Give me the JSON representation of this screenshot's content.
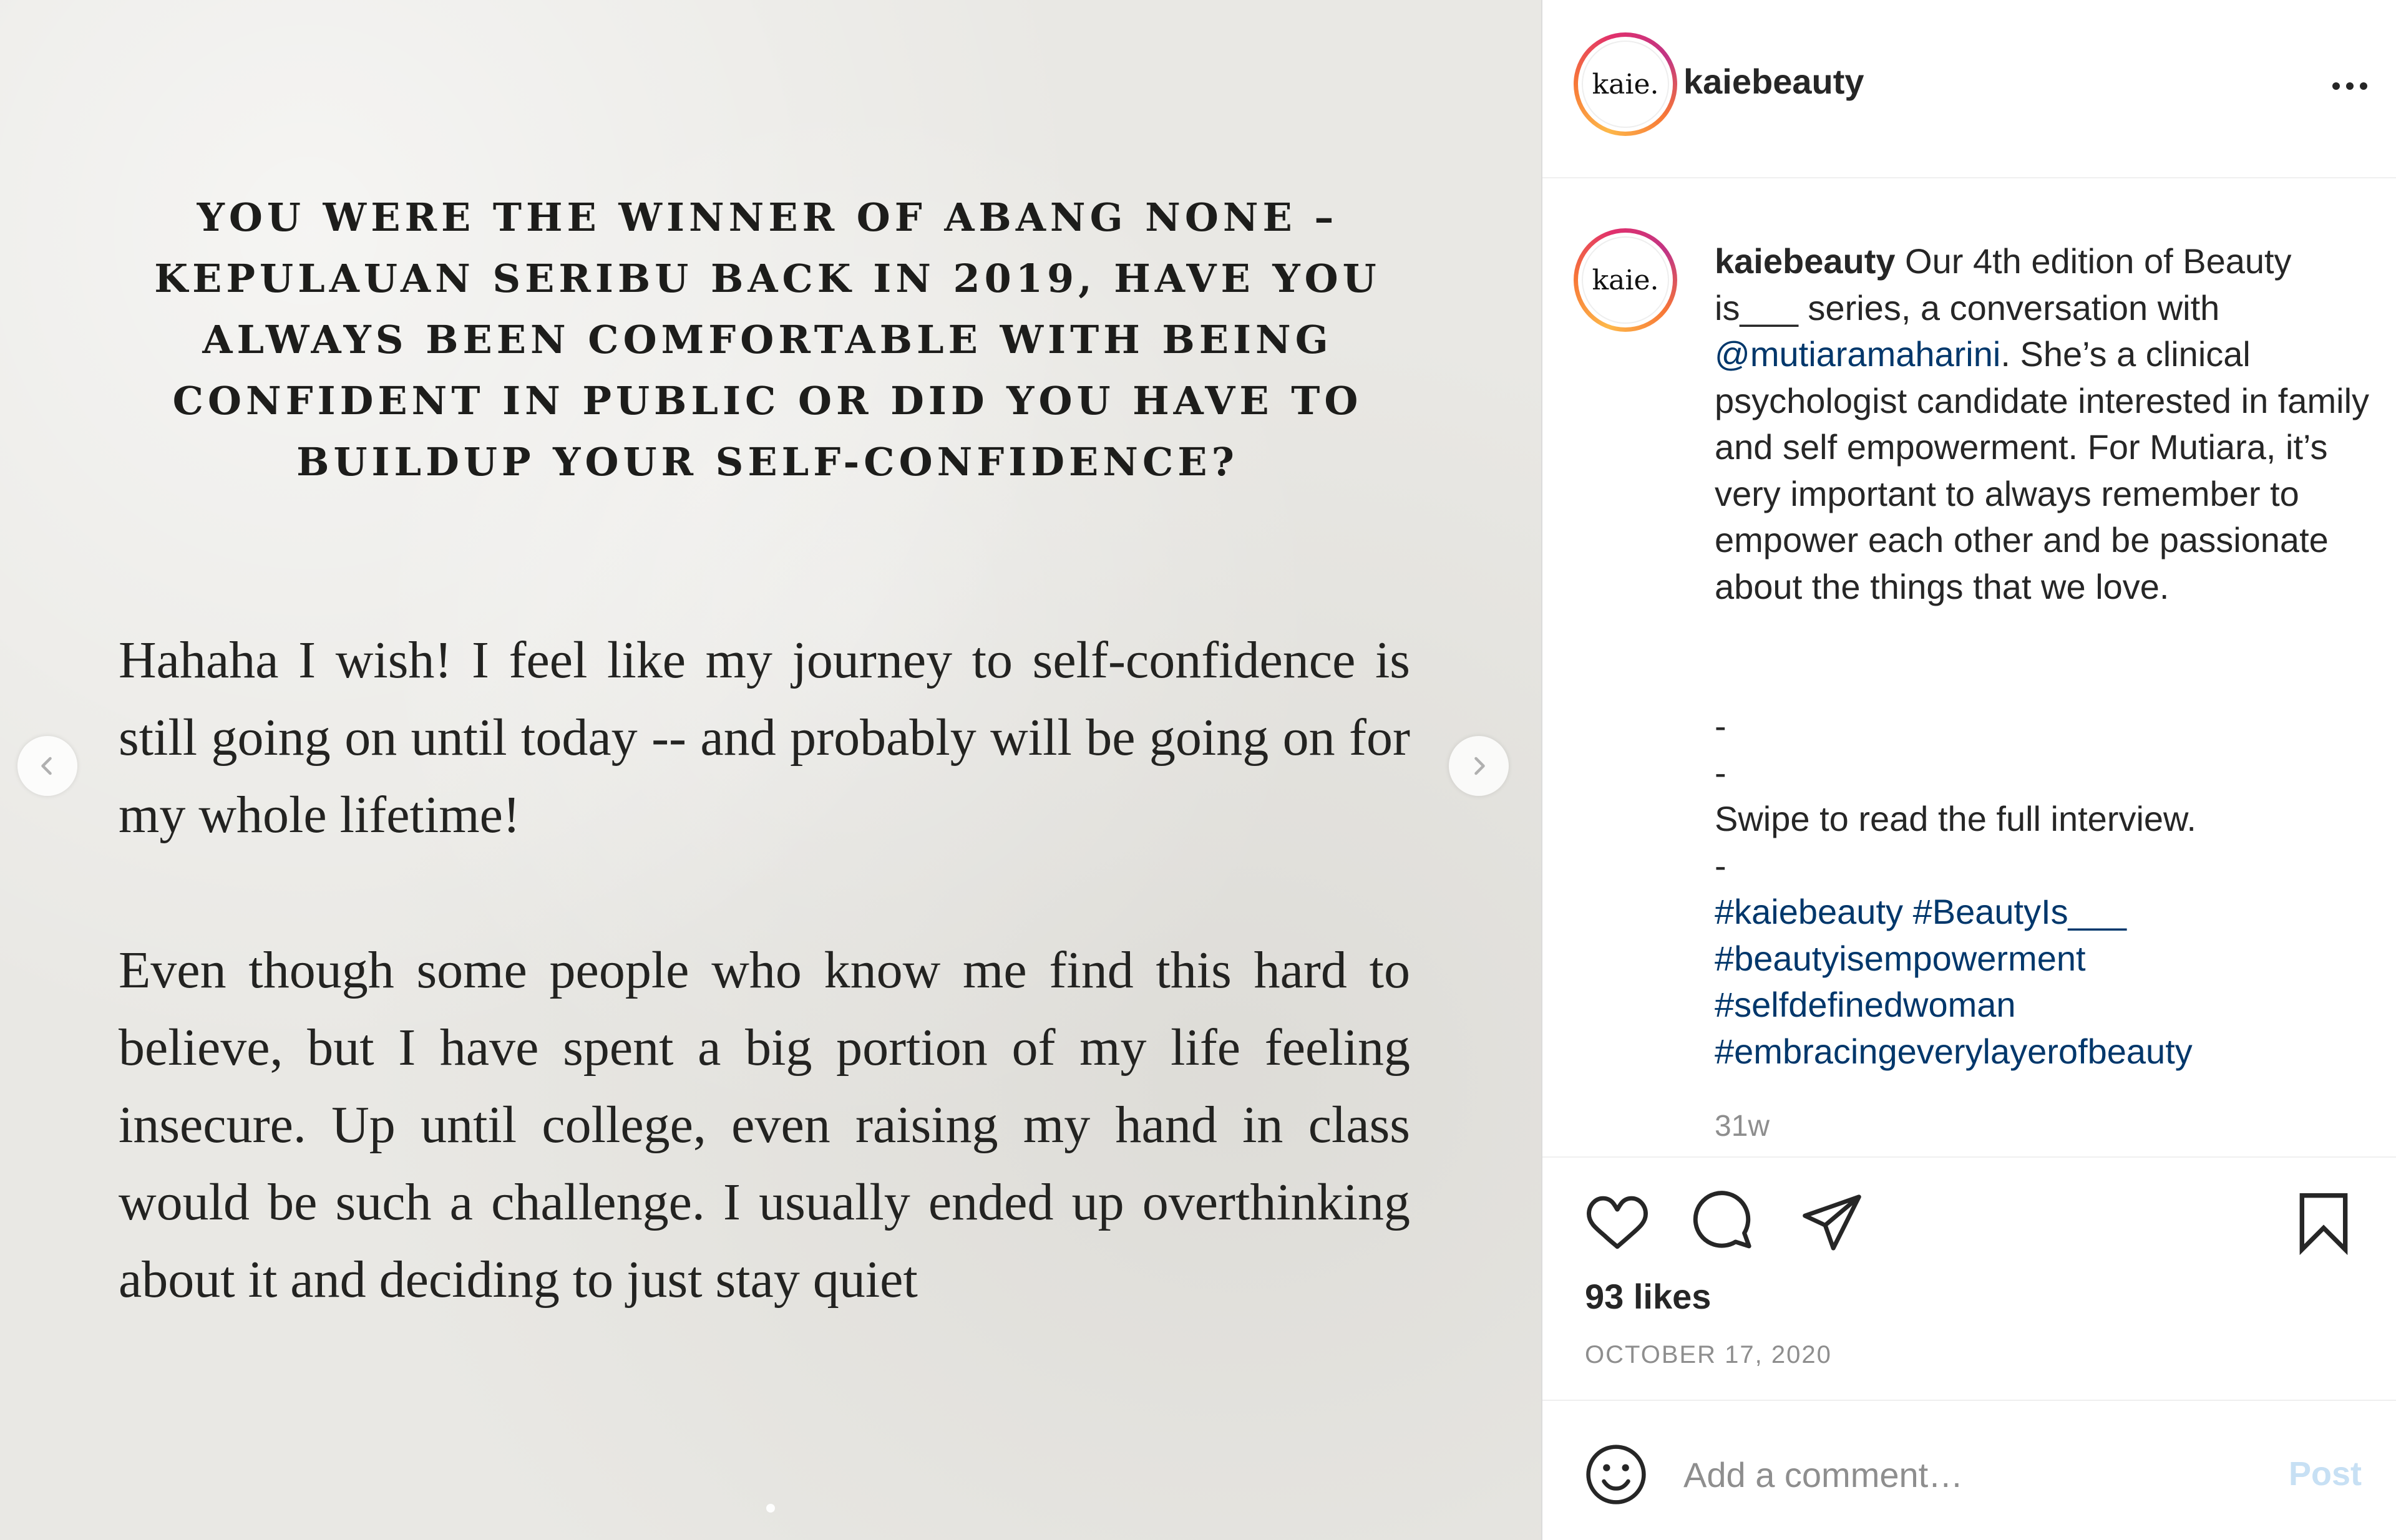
{
  "post": {
    "slide": {
      "heading": "YOU WERE THE WINNER OF ABANG NONE – KEPULAUAN SERIBU BACK IN 2019, HAVE YOU ALWAYS BEEN COMFORTABLE WITH BEING CONFIDENT IN PUBLIC OR DID YOU HAVE TO BUILDUP YOUR SELF-CONFIDENCE?",
      "paragraph_1": "Hahaha I wish! I feel like my journey to self-confidence is still going on until today -- and probably will be going on for my whole lifetime!",
      "paragraph_2": "Even though some people who know me find this hard to believe, but I have spent a big portion of my life feeling insecure. Up until college, even raising my hand in class would be such a challenge. I usually ended up overthinking about it and deciding to just stay quiet"
    },
    "header": {
      "username": "kaiebeauty",
      "avatar_text": "kaie."
    },
    "caption": {
      "username": "kaiebeauty",
      "text_1": " Our 4th edition of Beauty is___ series, a conversation with ",
      "mention": "@mutiaramaharini",
      "text_2": ". She’s a clinical psychologist candidate interested in family and self empowerment. For Mutiara, it’s very important to always remember to empower each other and be passionate about the things that we love.",
      "sep_1": "-",
      "sep_2": "-",
      "swipe": "Swipe to read the full interview.",
      "sep_3": "-",
      "hashtags": [
        "#kaiebeauty",
        "#BeautyIs___",
        "#beautyisempowerment",
        "#selfdefinedwoman",
        "#embracingeverylayerofbeauty"
      ],
      "time": "31w"
    },
    "likes": "93 likes",
    "date": "OCTOBER 17, 2020",
    "comment": {
      "placeholder": "Add a comment…",
      "post_label": "Post"
    }
  },
  "colors": {
    "link": "#00376b",
    "muted": "#8e8e8e",
    "text": "#262626",
    "post_disabled": "#c7e0f4",
    "slide_bg": "#e9e8e4"
  },
  "icons": [
    "chevron-left-icon",
    "chevron-right-icon",
    "more-icon",
    "heart-icon",
    "comment-icon",
    "share-icon",
    "bookmark-icon",
    "emoji-icon"
  ]
}
